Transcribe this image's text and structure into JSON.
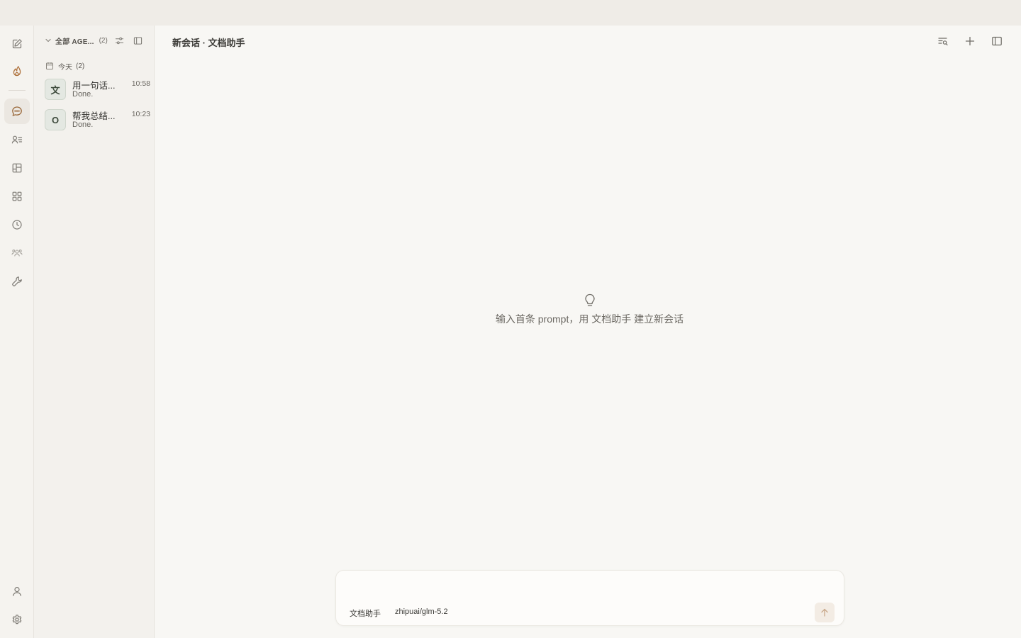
{
  "rail": {
    "top_items": [
      {
        "name": "new-chat-button",
        "icon": "edit-icon"
      },
      {
        "name": "hot-button",
        "icon": "flame-icon"
      }
    ],
    "items": [
      {
        "name": "conversations-nav",
        "icon": "chat-bubble-icon",
        "active": true
      },
      {
        "name": "agents-nav",
        "icon": "user-list-icon"
      },
      {
        "name": "board-nav",
        "icon": "board-icon"
      },
      {
        "name": "apps-nav",
        "icon": "grid-icon"
      },
      {
        "name": "history-nav",
        "icon": "clock-icon"
      },
      {
        "name": "team-nav",
        "icon": "team-icon"
      },
      {
        "name": "tools-nav",
        "icon": "wrench-icon"
      }
    ],
    "bottom_items": [
      {
        "name": "profile-button",
        "icon": "user-icon"
      },
      {
        "name": "settings-button",
        "icon": "gear-icon"
      }
    ]
  },
  "sidebar": {
    "filter_label": "全部 AGE...",
    "filter_count": "(2)",
    "group": {
      "label": "今天",
      "count": "(2)"
    },
    "sessions": [
      {
        "avatar": "文",
        "title": "用一句话...",
        "subtitle": "Done.",
        "time": "10:58"
      },
      {
        "avatar": "O",
        "title": "帮我总结...",
        "subtitle": "Done.",
        "time": "10:23"
      }
    ]
  },
  "main": {
    "title": "新会话 · 文档助手",
    "empty_hint": "输入首条 prompt，用 文档助手 建立新会话"
  },
  "composer": {
    "placeholder": "",
    "agent": "文档助手",
    "model": "zhipuai/glm-5.2"
  },
  "colors": {
    "accent": "#9b6a3c",
    "background": "#f8f7f4",
    "sidebar": "#f3f1ed",
    "send_button": "#f3ece4"
  }
}
